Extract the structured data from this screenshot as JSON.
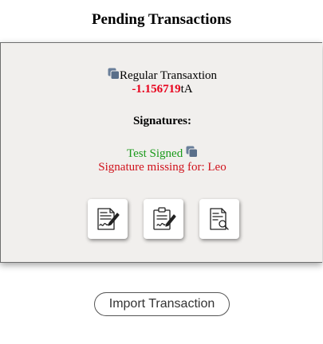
{
  "header": {
    "title": "Pending Transactions"
  },
  "transaction": {
    "type_label": "Regular Transaxtion",
    "amount": "-1.156719",
    "unit": "tA",
    "copy_icon": "copy-icon"
  },
  "signatures": {
    "heading": "Signatures:",
    "signed_text": "Test Signed",
    "missing_text": "Signature missing for: Leo"
  },
  "actions": [
    {
      "icon": "sign-document-icon"
    },
    {
      "icon": "clipboard-sign-icon"
    },
    {
      "icon": "inspect-document-icon"
    }
  ],
  "footer": {
    "import_label": "Import Transaction"
  },
  "colors": {
    "amount": "#e8001c",
    "signed": "#1a9a1a",
    "missing": "#d0111b",
    "panel_bg": "#f1efed",
    "copy_icon": "#5a6f8a"
  }
}
